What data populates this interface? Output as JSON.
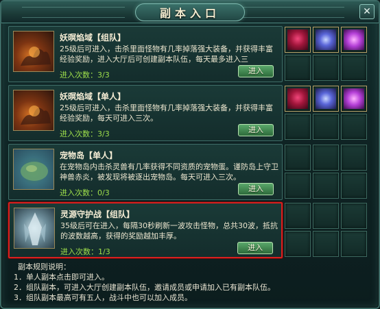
{
  "window": {
    "title": "副本入口",
    "close_label": "✕"
  },
  "dungeons": [
    {
      "name": "妖暝焰域【组队】",
      "description": "25级后可进入，击杀里面怪物有几率掉落强大装备，并获得丰富经验奖励，进入大厅后可创建副本队伍，每天最多进入三",
      "count_label": "进入次数：3/3",
      "enter_label": "进入",
      "rewards": [
        "armor",
        "weapon",
        "pet",
        "",
        "",
        ""
      ]
    },
    {
      "name": "妖暝焰域【单人】",
      "description": "25级后可进入，击杀里面怪物有几率掉落强大装备，并获得丰富经验奖励，每天可进入三次。",
      "count_label": "进入次数：3/3",
      "enter_label": "进入",
      "rewards": [
        "armor",
        "weapon",
        "pet",
        "",
        "",
        ""
      ]
    },
    {
      "name": "宠物岛【单人】",
      "description": "在宠物岛内击杀灵兽有几率获得不同资质的宠物蛋。谨防岛上守卫神兽赤炎，被发现将被逐出宠物岛。每天可进入三次。",
      "count_label": "进入次数：0/3",
      "enter_label": "进入",
      "rewards": [
        "",
        "",
        "",
        "",
        "",
        ""
      ]
    },
    {
      "name": "灵源守护战【组队】",
      "description": "35级后可在进入，每隔30秒刷新一波攻击怪物，总共30波，抵抗的波数越高，获得的奖励越加丰厚。",
      "count_label": "进入次数：1/3",
      "enter_label": "进入",
      "rewards": [
        "",
        "",
        "",
        "",
        "",
        ""
      ]
    }
  ],
  "rules": {
    "heading": "副本规则说明：",
    "lines": [
      "1．单人副本点击即可进入。",
      "2．组队副本，可进入大厅创建副本队伍，邀请成员或申请加入已有副本队伍。",
      "3．组队副本最高可有五人，战斗中也可以加入成员。"
    ]
  },
  "colors": {
    "accent_count": "#9fe04b",
    "selected_border": "#d8201f",
    "enter_button": "#3f8a4f"
  }
}
